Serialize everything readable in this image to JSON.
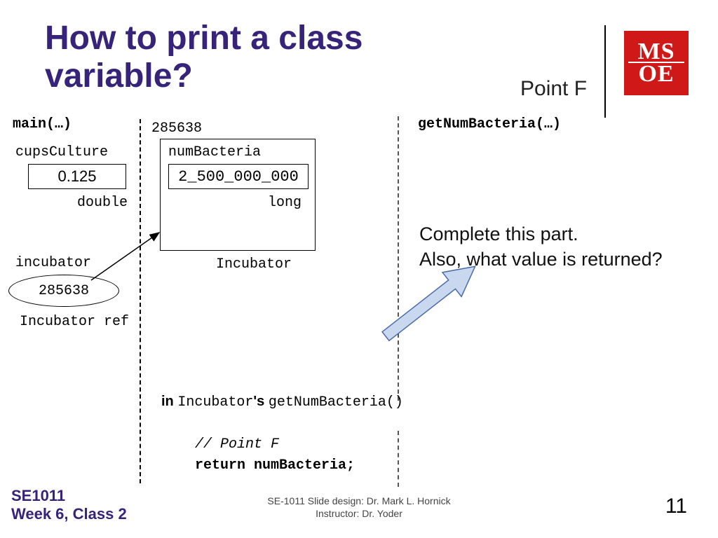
{
  "title": "How to print a class variable?",
  "point_label": "Point F",
  "logo": "MS\nOE",
  "labels": {
    "main": "main(…)",
    "addr": "285638",
    "getnum": "getNumBacteria(…)",
    "cups": "cupsCulture",
    "cups_val": "0.125",
    "double": "double",
    "incubator_var": "incubator",
    "incubator_ref_val": "285638",
    "incubator_ref_kind": "Incubator ref",
    "field_name": "numBacteria",
    "field_val": "2_500_000_000",
    "long": "long",
    "class_name": "Incubator"
  },
  "prompt_line1": "Complete this part.",
  "prompt_line2": "Also, what value is returned?",
  "code": {
    "line1_in": "in ",
    "line1_class": "Incubator",
    "line1_s": "'s ",
    "line1_method": "getNumBacteria()",
    "line2": "// Point F",
    "line3": "return numBacteria;"
  },
  "footer": {
    "course": "SE1011",
    "week": "Week 6, Class 2",
    "design": "SE-1011 Slide design: Dr. Mark L. Hornick",
    "instructor": "Instructor: Dr. Yoder",
    "slide_no": "11"
  }
}
